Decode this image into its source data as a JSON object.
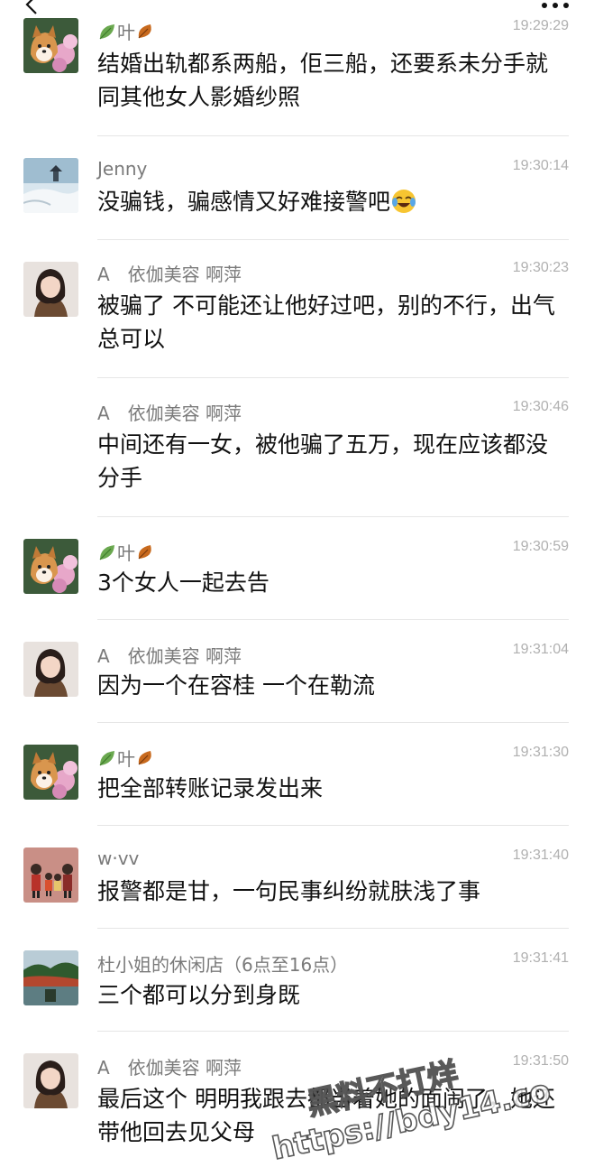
{
  "header": {
    "back_icon": "chevron-left-icon",
    "more_icon": "more-dots-icon"
  },
  "colors": {
    "name": "#7a7a7a",
    "time": "#b0b0b0",
    "text": "#111111",
    "divider": "#e6e6e6"
  },
  "messages": [
    {
      "name": "叶",
      "name_icons": [
        "green-leaf-icon",
        "autumn-leaf-icon"
      ],
      "time": "19:29:29",
      "text": "结婚出轨都系两船，佢三船，还要系未分手就同其他女人影婚纱照",
      "avatar": "corgi-flowers",
      "show_avatar": true
    },
    {
      "name": "Jenny",
      "time": "19:30:14",
      "text": "没骗钱，骗感情又好难接警吧",
      "text_icon": "laughing-tears-emoji",
      "avatar": "snow-pavilion",
      "show_avatar": true
    },
    {
      "name": "A　依伽美容 啊萍",
      "time": "19:30:23",
      "text": "被骗了 不可能还让他好过吧，别的不行，出气总可以",
      "avatar": "woman-portrait",
      "show_avatar": true
    },
    {
      "name": "A　依伽美容 啊萍",
      "time": "19:30:46",
      "text": "中间还有一女，被他骗了五万，现在应该都没分手",
      "avatar": "woman-portrait",
      "show_avatar": false
    },
    {
      "name": "叶",
      "name_icons": [
        "green-leaf-icon",
        "autumn-leaf-icon"
      ],
      "time": "19:30:59",
      "text": "3个女人一起去告",
      "avatar": "corgi-flowers",
      "show_avatar": true
    },
    {
      "name": "A　依伽美容 啊萍",
      "time": "19:31:04",
      "text": "因为一个在容桂 一个在勒流",
      "avatar": "woman-portrait",
      "show_avatar": true
    },
    {
      "name": "叶",
      "name_icons": [
        "green-leaf-icon",
        "autumn-leaf-icon"
      ],
      "time": "19:31:30",
      "text": "把全部转账记录发出来",
      "avatar": "corgi-flowers",
      "show_avatar": true
    },
    {
      "name": "w·vv",
      "time": "19:31:40",
      "text": "报警都是甘，一句民事纠纷就肤浅了事",
      "avatar": "family-cartoon",
      "show_avatar": true
    },
    {
      "name": "杜小姐的休闲店（6点至16点）",
      "time": "19:31:41",
      "text": "三个都可以分到身既",
      "avatar": "lake-landscape",
      "show_avatar": true
    },
    {
      "name": "A　依伽美容 啊萍",
      "time": "19:31:50",
      "text": "最后这个 明明我跟去都当着她的面闹了，她还带他回去见父母",
      "avatar": "woman-portrait",
      "show_avatar": true
    }
  ],
  "watermark": {
    "line1": "黑料不打烊",
    "line2": "https://bdy14.co"
  }
}
